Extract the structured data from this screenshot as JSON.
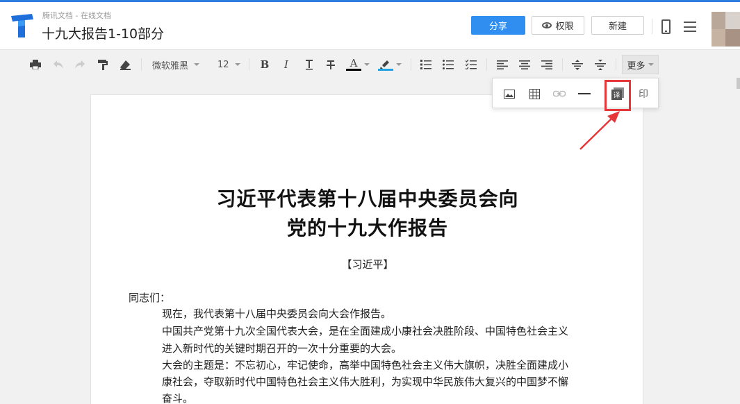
{
  "app": {
    "subtitle": "腾讯文档 - 在线文档",
    "doc_title": "十九大报告1-10部分",
    "logo_icon": "tencent-docs-logo-icon",
    "accent_color": "#2f8ef0"
  },
  "header": {
    "share_label": "分享",
    "permission_label": "权限",
    "new_label": "新建"
  },
  "toolbar": {
    "font_family": "微软雅黑",
    "font_size": "12",
    "bold": "B",
    "italic": "I",
    "text_color_letter": "A",
    "more_label": "更多"
  },
  "more_menu": {
    "items": [
      "image-icon",
      "table-icon",
      "link-icon",
      "horizontal-line-icon",
      "translate-icon",
      "print-icon"
    ],
    "translate_glyph": "译",
    "print_glyph": "印",
    "highlight_color": "#e5373a"
  },
  "document": {
    "title_line1": "习近平代表第十八届中央委员会向",
    "title_line2": "党的十九大作报告",
    "author": "【习近平】",
    "salutation": "同志们：",
    "paragraphs": [
      "现在，我代表第十八届中央委员会向大会作报告。",
      "中国共产党第十九次全国代表大会，是在全面建成小康社会决胜阶段、中国特色社会主义",
      "进入新时代的关键时期召开的一次十分重要的大会。",
      "大会的主题是：不忘初心，牢记使命，高举中国特色社会主义伟大旗帜，决胜全面建成小",
      "康社会，夺取新时代中国特色社会主义伟大胜利，为实现中华民族伟大复兴的中国梦不懈",
      "奋斗。"
    ]
  }
}
